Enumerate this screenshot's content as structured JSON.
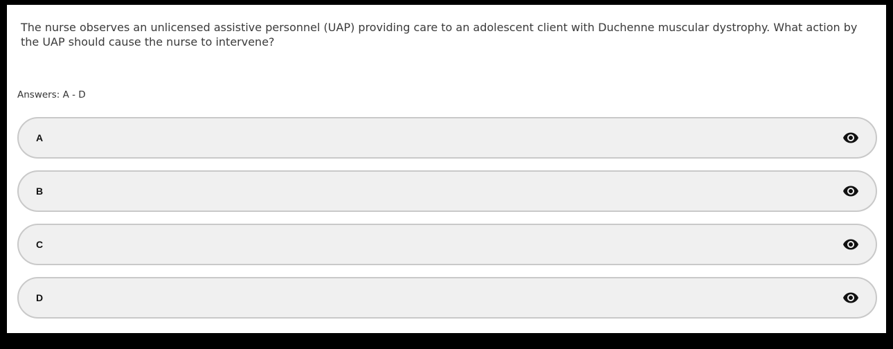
{
  "question": {
    "text": "The nurse observes an unlicensed assistive personnel (UAP) providing care to an adolescent client with Duchenne muscular dystrophy. What action by the UAP should cause the nurse to intervene?"
  },
  "answers_label": "Answers: A - D",
  "options": [
    {
      "letter": "A",
      "icon": "eye-icon"
    },
    {
      "letter": "B",
      "icon": "eye-icon"
    },
    {
      "letter": "C",
      "icon": "eye-icon"
    },
    {
      "letter": "D",
      "icon": "eye-icon"
    }
  ]
}
